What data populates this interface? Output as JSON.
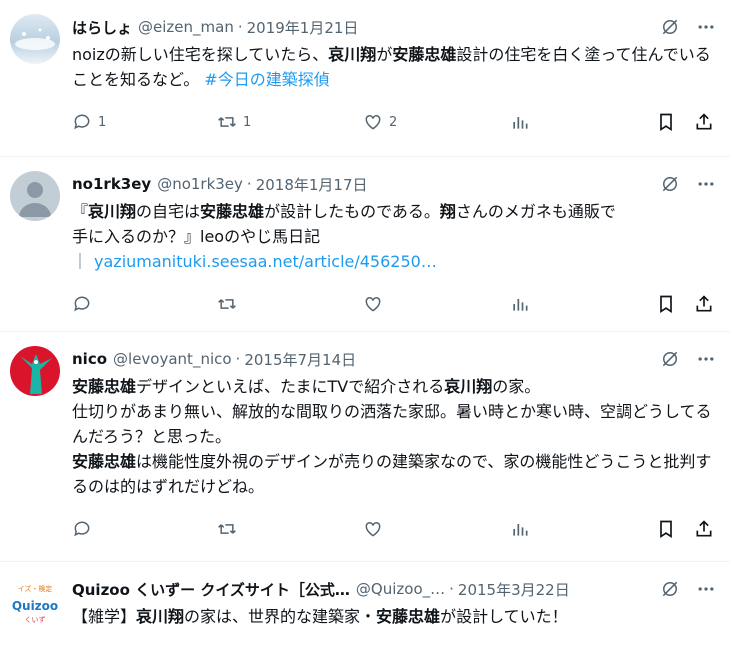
{
  "tweets": [
    {
      "name": "はらしょ",
      "handle": "@eizen_man",
      "date": "2019年1月21日",
      "text_parts": [
        {
          "t": "noizの新しい住宅を探していたら、",
          "b": false
        },
        {
          "t": "哀川翔",
          "b": true
        },
        {
          "t": "が",
          "b": false
        },
        {
          "t": "安藤忠雄",
          "b": true
        },
        {
          "t": "設計の住宅を白く塗って住んでいることを知るなど。 ",
          "b": false
        }
      ],
      "hashtag": "#今日の建築探偵",
      "reply_count": "1",
      "retweet_count": "1",
      "like_count": "2"
    },
    {
      "name": "no1rk3ey",
      "handle": "@no1rk3ey",
      "date": "2018年1月17日",
      "line1_parts": [
        "『",
        "哀川翔",
        "の自宅は",
        "安藤忠雄",
        "が設計したものである。",
        "翔",
        "さんのメガネも通販で"
      ],
      "line2": "手に入るのか？』leoのやじ馬日記",
      "link": "yaziumanituki.seesaa.net/article/456250…",
      "reply_count": "",
      "retweet_count": "",
      "like_count": ""
    },
    {
      "name": "nico",
      "handle": "@levoyant_nico",
      "date": "2015年7月14日",
      "p1": [
        "安藤忠雄",
        "デザインといえば、たまにTVで紹介される",
        "哀川翔",
        "の家。"
      ],
      "p2": "仕切りがあまり無い、解放的な間取りの洒落た家邸。暑い時とか寒い時、空調どうしてるんだろう？と思った。",
      "p3": [
        "安藤忠雄",
        "は機能性度外視のデザインが売りの建築家なので、家の機能性どうこうと批判するのは的はずれだけどね。"
      ]
    },
    {
      "name": "Quizoo くいずー クイズサイト［公式…",
      "handle": "@Quizoo_…",
      "date": "2015年3月22日",
      "parts": [
        "【雑学】",
        "哀川翔",
        "の家は、世界的な建築家・",
        "安藤忠雄",
        "が設計していた！"
      ],
      "logo_text": "Quizoo",
      "logo_top": "イズ・検定",
      "logo_bottom": "くいず"
    }
  ],
  "sep": "·",
  "colors": {
    "accent": "#1d9bf0",
    "muted": "#536471"
  }
}
